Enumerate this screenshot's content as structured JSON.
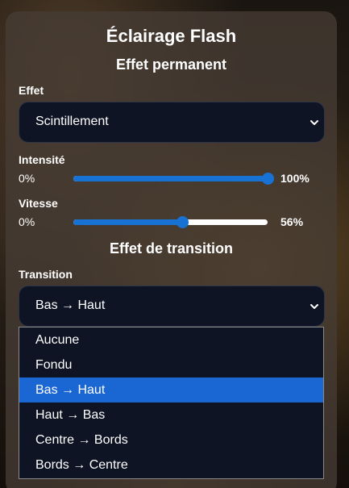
{
  "panel": {
    "title": "Éclairage Flash"
  },
  "permanent": {
    "heading": "Effet permanent",
    "effect": {
      "label": "Effet",
      "value": "Scintillement"
    },
    "intensity": {
      "label": "Intensité",
      "min_label": "0%",
      "value_label": "100%",
      "value": 100
    },
    "speed": {
      "label": "Vitesse",
      "min_label": "0%",
      "value_label": "56%",
      "value": 56
    }
  },
  "transition": {
    "heading": "Effet de transition",
    "label": "Transition",
    "value": "Bas → Haut",
    "options": [
      "Aucune",
      "Fondu",
      "Bas → Haut",
      "Haut → Bas",
      "Centre → Bords",
      "Bords → Centre"
    ],
    "selected_index": 2
  },
  "colors": {
    "accent": "#1872d4",
    "highlight": "#1a66d2",
    "select_bg": "#0e1424"
  },
  "icons": {
    "select_arrow": "chevron-down-icon"
  }
}
